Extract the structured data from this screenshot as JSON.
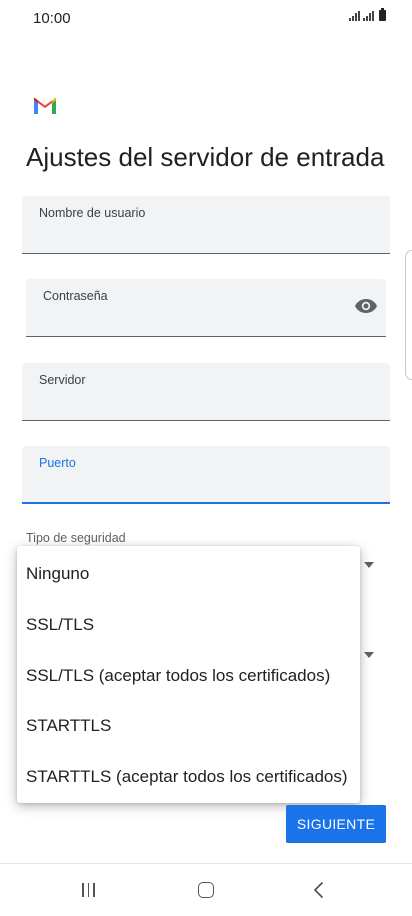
{
  "status_bar": {
    "time": "10:00"
  },
  "header": {
    "title": "Ajustes del servidor de entrada"
  },
  "form": {
    "username_label": "Nombre de usuario",
    "password_label": "Contraseña",
    "server_label": "Servidor",
    "port_label": "Puerto",
    "security_label": "Tipo de seguridad"
  },
  "dropdown": {
    "options": [
      "Ninguno",
      "SSL/TLS",
      "SSL/TLS (aceptar todos los certificados)",
      "STARTTLS",
      "STARTTLS (aceptar todos los certificados)"
    ]
  },
  "actions": {
    "next_label": "SIGUIENTE"
  },
  "colors": {
    "accent": "#1a73e8",
    "field_bg": "#f1f3f4"
  }
}
